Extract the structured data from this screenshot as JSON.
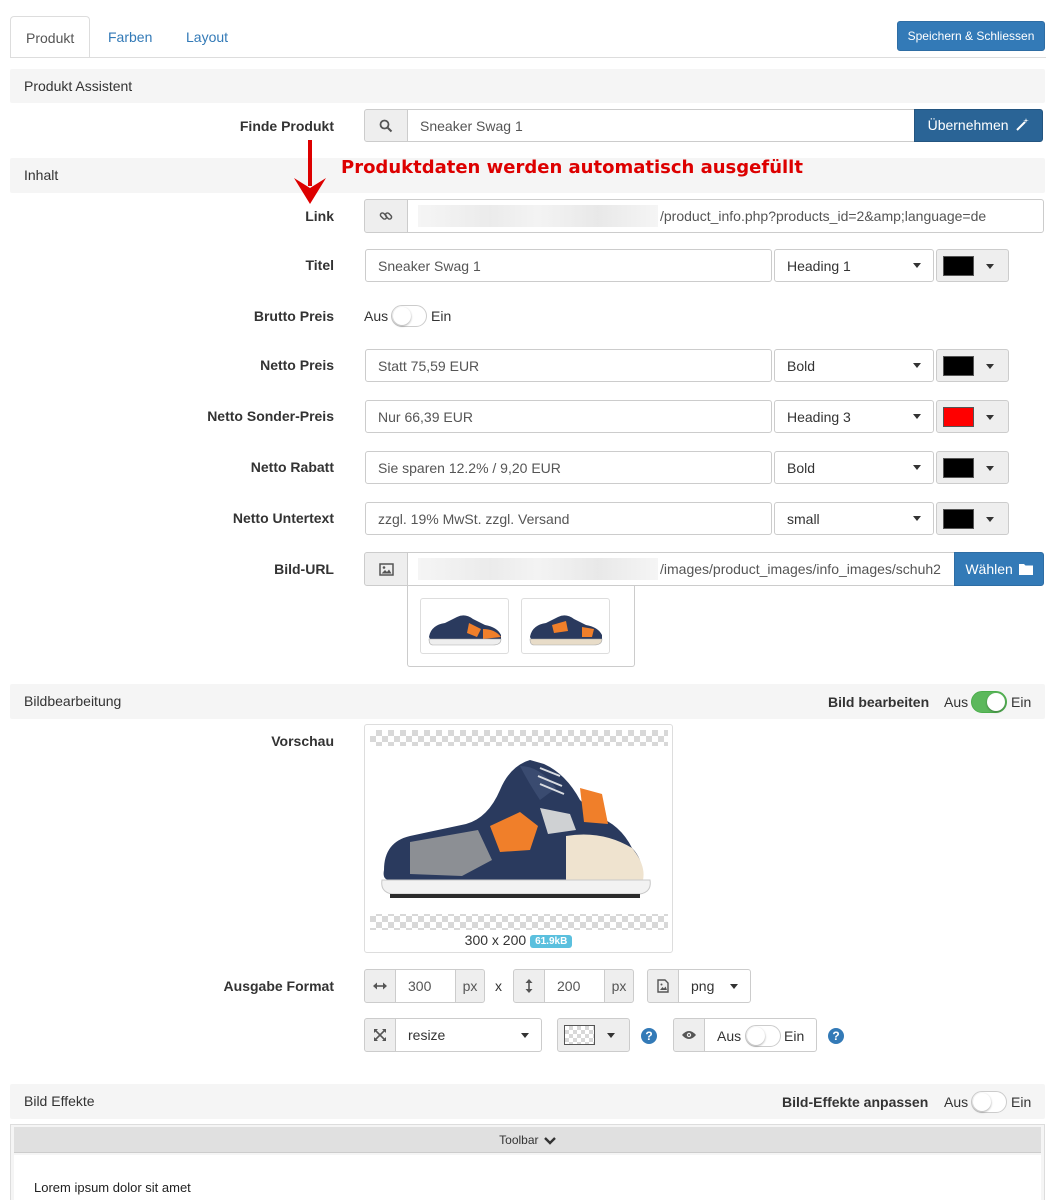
{
  "tabs": [
    {
      "label": "Produkt",
      "active": true
    },
    {
      "label": "Farben",
      "active": false
    },
    {
      "label": "Layout",
      "active": false
    }
  ],
  "save_button": "Speichern & Schliessen",
  "sections": {
    "assistant": "Produkt Assistent",
    "content": "Inhalt",
    "image_edit": "Bildbearbeitung",
    "effects": "Bild Effekte"
  },
  "find": {
    "label": "Finde Produkt",
    "value": "Sneaker Swag 1",
    "apply_button": "Übernehmen"
  },
  "annotation": "Produktdaten werden automatisch ausgefüllt",
  "link": {
    "label": "Link",
    "value": "/product_info.php?products_id=2&amp;language=de"
  },
  "fields": [
    {
      "label": "Titel",
      "value": "Sneaker Swag 1",
      "style": "Heading 1",
      "color": "#000000"
    },
    {
      "label": "Netto Preis",
      "value": "Statt 75,59 EUR",
      "style": "Bold",
      "color": "#000000"
    },
    {
      "label": "Netto Sonder-Preis",
      "value": "Nur 66,39 EUR",
      "style": "Heading 3",
      "color": "#ff0000"
    },
    {
      "label": "Netto Rabatt",
      "value": "Sie sparen 12.2% / 9,20 EUR",
      "style": "Bold",
      "color": "#000000"
    },
    {
      "label": "Netto Untertext",
      "value": "zzgl. 19% MwSt. zzgl. Versand",
      "style": "small",
      "color": "#000000"
    }
  ],
  "brutto": {
    "label": "Brutto Preis",
    "off": "Aus",
    "on": "Ein",
    "enabled": false
  },
  "image_url": {
    "label": "Bild-URL",
    "value": "/images/product_images/info_images/schuh2",
    "choose_button": "Wählen"
  },
  "edit_toggle": {
    "label": "Bild bearbeiten",
    "off": "Aus",
    "on": "Ein",
    "enabled": true
  },
  "preview": {
    "label": "Vorschau",
    "size": "300 x 200",
    "filesize": "61.9kB"
  },
  "output": {
    "label": "Ausgabe Format",
    "width": "300",
    "height": "200",
    "unit": "px",
    "times": "x",
    "format": "png",
    "mode": "resize",
    "visibility_off": "Aus",
    "visibility_on": "Ein",
    "help": "?"
  },
  "effects_toggle": {
    "label": "Bild-Effekte anpassen",
    "off": "Aus",
    "on": "Ein",
    "enabled": false
  },
  "editor": {
    "toolbar": "Toolbar",
    "text": "Lorem ipsum dolor sit amet"
  },
  "colors": {
    "primary": "#337ab7",
    "success": "#5cb85c",
    "annotation": "#dd0000",
    "navy": "#2a3a5e",
    "orange": "#f07f2a"
  }
}
